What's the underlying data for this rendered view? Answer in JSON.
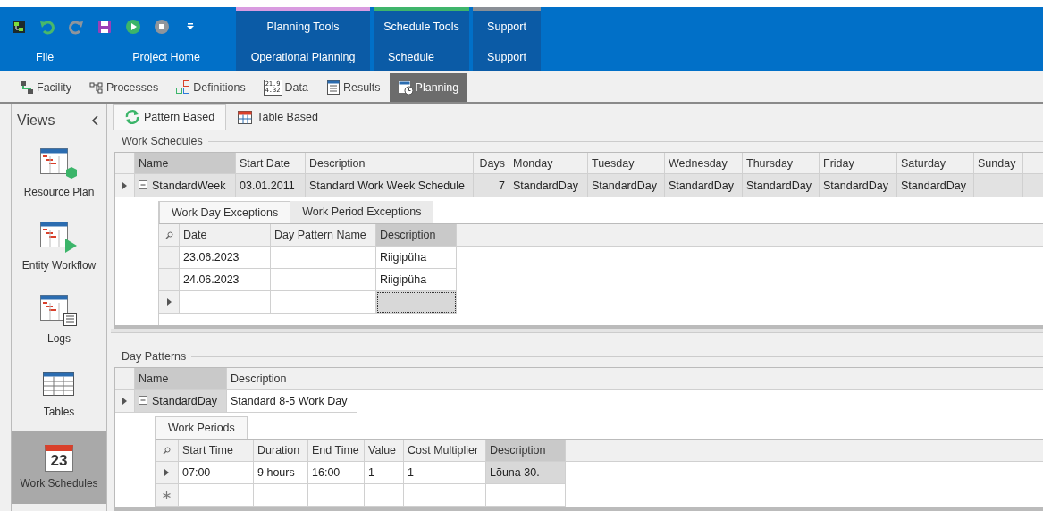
{
  "quick_access": [
    {
      "kind": "app"
    },
    {
      "kind": "undo",
      "disabled": false
    },
    {
      "kind": "redo",
      "disabled": true
    },
    {
      "kind": "save",
      "disabled": false
    },
    {
      "kind": "run",
      "disabled": false
    },
    {
      "kind": "stop",
      "disabled": true
    },
    {
      "kind": "more"
    }
  ],
  "ribbon": {
    "tabs": [
      {
        "label": "File"
      },
      {
        "label": "Project Home"
      }
    ],
    "groups": [
      {
        "title": "Planning Tools",
        "color": "#d99be0",
        "tabs": [
          {
            "label": "Operational Planning"
          }
        ]
      },
      {
        "title": "Schedule Tools",
        "color": "#3fb56b",
        "tabs": [
          {
            "label": "Schedule"
          }
        ]
      },
      {
        "title": "Support",
        "color": "#8a8f96",
        "tabs": [
          {
            "label": "Support"
          }
        ]
      }
    ]
  },
  "modules": [
    {
      "label": "Facility",
      "kind": "facility",
      "selected": false
    },
    {
      "label": "Processes",
      "kind": "processes",
      "selected": false
    },
    {
      "label": "Definitions",
      "kind": "definitions",
      "selected": false
    },
    {
      "label": "Data",
      "kind": "data",
      "selected": false,
      "icon_lines": [
        "21.9",
        "4.32"
      ]
    },
    {
      "label": "Results",
      "kind": "results",
      "selected": false
    },
    {
      "label": "Planning",
      "kind": "planning",
      "selected": true
    }
  ],
  "views": {
    "title": "Views",
    "items": [
      {
        "label": "Resource Plan",
        "kind": "resource",
        "selected": false
      },
      {
        "label": "Entity Workflow",
        "kind": "workflow",
        "selected": false
      },
      {
        "label": "Logs",
        "kind": "logs",
        "selected": false
      },
      {
        "label": "Tables",
        "kind": "tables",
        "selected": false
      },
      {
        "label": "Work Schedules",
        "kind": "calendar",
        "selected": true,
        "icon_text": "23"
      }
    ]
  },
  "view_tabs": [
    {
      "label": "Pattern Based",
      "kind": "pattern",
      "selected": true
    },
    {
      "label": "Table Based",
      "kind": "table",
      "selected": false
    }
  ],
  "work_schedules": {
    "title": "Work Schedules",
    "columns": [
      {
        "label": "Name",
        "focused": true
      },
      {
        "label": "Start Date",
        "focused": false
      },
      {
        "label": "Description",
        "focused": false
      },
      {
        "label": "Days",
        "focused": false,
        "kind": "number"
      },
      {
        "label": "Monday",
        "focused": false
      },
      {
        "label": "Tuesday",
        "focused": false
      },
      {
        "label": "Wednesday",
        "focused": false
      },
      {
        "label": "Thursday",
        "focused": false
      },
      {
        "label": "Friday",
        "focused": false
      },
      {
        "label": "Saturday",
        "focused": false
      },
      {
        "label": "Sunday",
        "focused": false
      }
    ],
    "rows": [
      {
        "selected": true,
        "expanded": true,
        "cells": [
          "StandardWeek",
          "03.01.2011",
          "Standard Work Week Schedule",
          "7",
          "StandardDay",
          "StandardDay",
          "StandardDay",
          "StandardDay",
          "StandardDay",
          "StandardDay"
        ],
        "detail": {
          "tabs": [
            {
              "label": "Work Day Exceptions",
              "selected": true
            },
            {
              "label": "Work Period Exceptions",
              "selected": false
            }
          ],
          "columns": [
            {
              "label": "Date",
              "focused": false
            },
            {
              "label": "Day Pattern Name",
              "focused": false
            },
            {
              "label": "Description",
              "focused": true
            }
          ],
          "rows": [
            {
              "kind": "data",
              "current": false,
              "cells": {
                "0": "23.06.2023",
                "2": "Riigipüha"
              }
            },
            {
              "kind": "data",
              "current": false,
              "cells": {
                "0": "24.06.2023",
                "2": "Riigipüha"
              }
            },
            {
              "kind": "new",
              "current": true,
              "cells": {}
            }
          ]
        }
      }
    ]
  },
  "day_patterns": {
    "title": "Day Patterns",
    "columns": [
      {
        "label": "Name",
        "focused": true
      },
      {
        "label": "Description",
        "focused": false
      }
    ],
    "rows": [
      {
        "selected": true,
        "expanded": true,
        "cells": [
          "StandardDay",
          "Standard 8-5 Work Day"
        ],
        "detail": {
          "tabs": [
            {
              "label": "Work Periods",
              "selected": true
            }
          ],
          "columns": [
            {
              "label": "Start Time",
              "focused": false
            },
            {
              "label": "Duration",
              "focused": false
            },
            {
              "label": "End Time",
              "focused": false
            },
            {
              "label": "Value",
              "focused": false
            },
            {
              "label": "Cost Multiplier",
              "focused": false
            },
            {
              "label": "Description",
              "focused": true
            }
          ],
          "rows": [
            {
              "kind": "data",
              "current": true,
              "cells": {
                "0": "07:00",
                "1": "9 hours",
                "2": "16:00",
                "3": "1",
                "4": "1",
                "5": "Lõuna 30."
              }
            },
            {
              "kind": "new",
              "current": false,
              "cells": {}
            }
          ]
        }
      }
    ]
  }
}
